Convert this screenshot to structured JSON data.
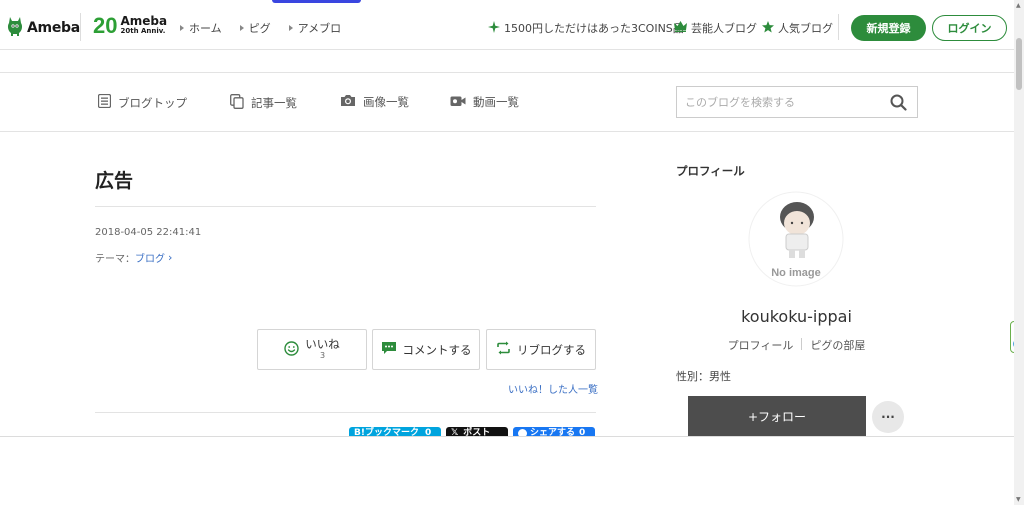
{
  "header": {
    "logo_text": "Ameba",
    "anniv_number": "20",
    "anniv_title": "Ameba",
    "anniv_sub": "20th Anniv.",
    "nav": [
      {
        "label": "ホーム"
      },
      {
        "label": "ピグ"
      },
      {
        "label": "アメブロ"
      }
    ],
    "promo_link": "1500円しただけはあった3COINS品",
    "celeb_link": "芸能人ブログ",
    "popular_link": "人気ブログ",
    "register_label": "新規登録",
    "login_label": "ログイン"
  },
  "blognav": {
    "items": [
      {
        "label": "ブログトップ",
        "icon": "document-icon"
      },
      {
        "label": "記事一覧",
        "icon": "copy-icon"
      },
      {
        "label": "画像一覧",
        "icon": "camera-icon"
      },
      {
        "label": "動画一覧",
        "icon": "video-icon"
      }
    ],
    "search_placeholder": "このブログを検索する"
  },
  "article": {
    "title": "広告",
    "date": "2018-04-05 22:41:41",
    "theme_label": "テーマ：",
    "theme_value": "ブログ",
    "like_label": "いいね",
    "like_count": "3",
    "comment_label": "コメントする",
    "reblog_label": "リブログする",
    "likes_list_label": "いいね！した人一覧",
    "share": {
      "hatena": "B!ブックマーク",
      "hatena_count": "0",
      "post": "ポスト",
      "facebook": "シェアする",
      "facebook_count": "0"
    }
  },
  "sidebar": {
    "heading": "プロフィール",
    "noimage_text": "No image",
    "username": "koukoku-ippai",
    "profile_link": "プロフィール",
    "pigg_link": "ピグの部屋",
    "gender": "性別：男性",
    "follow_label": "+フォロー",
    "more_label": "···"
  },
  "colors": {
    "brand_green": "#2d8c3c",
    "link_blue": "#3a6fc4",
    "follow_bg": "#4d4d4d"
  }
}
